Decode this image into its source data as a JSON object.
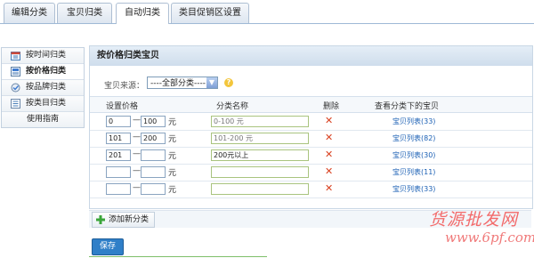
{
  "tabs": [
    "编辑分类",
    "宝贝归类",
    "自动归类",
    "类目促销区设置"
  ],
  "sidebar": {
    "items": [
      {
        "label": "按时间归类",
        "icon": "calendar-icon"
      },
      {
        "label": "按价格归类",
        "icon": "price-icon"
      },
      {
        "label": "按品牌归类",
        "icon": "brand-icon"
      },
      {
        "label": "按类目归类",
        "icon": "category-icon"
      },
      {
        "label": "使用指南",
        "icon": ""
      }
    ],
    "active_index": 1
  },
  "panel": {
    "title": "按价格归类宝贝",
    "source_label": "宝贝来源：",
    "source_value": "----全部分类----",
    "columns": {
      "price": "设置价格",
      "name": "分类名称",
      "delete": "删除",
      "view": "查看分类下的宝贝"
    },
    "rows": [
      {
        "min": "0",
        "max": "100",
        "unit": "元",
        "name": "0-100 元",
        "filled": false,
        "link": "宝贝列表(33)"
      },
      {
        "min": "101",
        "max": "200",
        "unit": "元",
        "name": "101-200 元",
        "filled": false,
        "link": "宝贝列表(82)"
      },
      {
        "min": "201",
        "max": "",
        "unit": "元",
        "name": "200元以上",
        "filled": true,
        "link": "宝贝列表(30)"
      },
      {
        "min": "",
        "max": "",
        "unit": "元",
        "name": "",
        "filled": false,
        "link": "宝贝列表(11)"
      },
      {
        "min": "",
        "max": "",
        "unit": "元",
        "name": "",
        "filled": false,
        "link": "宝贝列表(33)"
      }
    ],
    "delete_symbol": "✕"
  },
  "actions": {
    "add_label": "添加新分类",
    "save_label": "保存"
  },
  "watermark": {
    "main": "货源批发网",
    "url": "www.6pf.com"
  },
  "colors": {
    "accent": "#2f7fc8",
    "delete": "#d9401f",
    "link": "#1a5fb4"
  }
}
